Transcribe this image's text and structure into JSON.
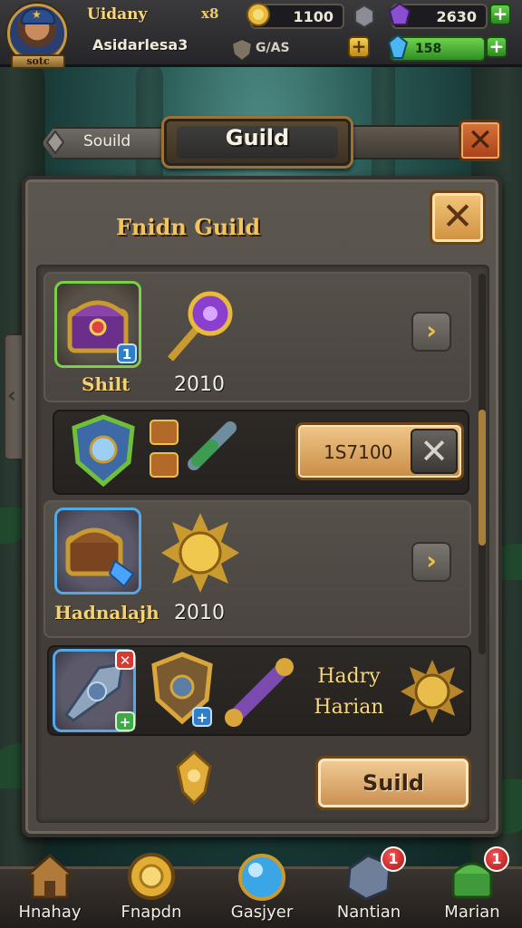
{
  "player": {
    "name": "Uidany",
    "guild": "Asidarlesa3",
    "level": "x8",
    "tag": "sotc"
  },
  "resources": {
    "gold": "1100",
    "crystal": "2630",
    "energy_label": "G/AS",
    "mana": "158"
  },
  "header": {
    "tab_left": "Souild",
    "title": "Guild"
  },
  "panel": {
    "title": "Fnidn Guild"
  },
  "rows": [
    {
      "name": "Shilt",
      "value": "2010"
    },
    {
      "price": "1S7100"
    },
    {
      "name": "Hadnalajh",
      "value": "2010"
    },
    {
      "hero_line1": "Hadry",
      "hero_line2": "Harian"
    }
  ],
  "actions": {
    "guild_button": "Suild"
  },
  "nav": [
    {
      "label": "Hnahay",
      "icon": "house-icon"
    },
    {
      "label": "Fnapdn",
      "icon": "gold-coin-icon"
    },
    {
      "label": "Gasjyer",
      "icon": "blue-orb-icon"
    },
    {
      "label": "Nantian",
      "icon": "iron-ore-icon",
      "badge": "1"
    },
    {
      "label": "Marian",
      "icon": "green-chest-icon",
      "badge": "1"
    }
  ],
  "colors": {
    "accent_gold": "#f1c45c",
    "panel": "#4d4843",
    "close": "#d18f3d",
    "plus": "#3fae2a"
  }
}
